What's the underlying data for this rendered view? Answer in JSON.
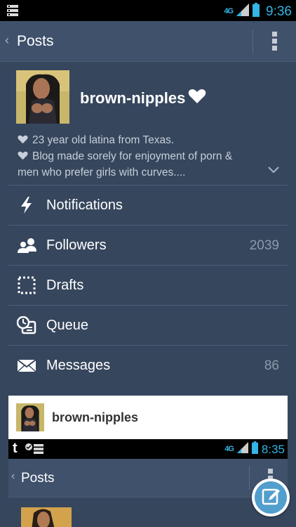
{
  "status_bar": {
    "network": "4G",
    "time": "9:36"
  },
  "action_bar": {
    "title": "Posts",
    "icons": [
      "chevron-left-icon",
      "overflow-menu-icon"
    ]
  },
  "profile": {
    "blog_name": "brown-nipples",
    "description_lines": [
      "23 year old latina from Texas.",
      "Blog made sorely for enjoyment of porn &",
      "men who prefer girls with curves...."
    ]
  },
  "menu": {
    "items": [
      {
        "label": "Notifications",
        "icon": "lightning-icon",
        "count": ""
      },
      {
        "label": "Followers",
        "icon": "followers-icon",
        "count": "2039"
      },
      {
        "label": "Drafts",
        "icon": "drafts-icon",
        "count": ""
      },
      {
        "label": "Queue",
        "icon": "queue-icon",
        "count": ""
      },
      {
        "label": "Messages",
        "icon": "envelope-icon",
        "count": "86"
      }
    ]
  },
  "card": {
    "blog_name": "brown-nipples"
  },
  "nested": {
    "network": "4G",
    "time": "8:35",
    "title": "Posts"
  },
  "colors": {
    "background": "#36465d",
    "action_bar": "#3f516b",
    "accent": "#529ecc",
    "status_text": "#33b5e5"
  }
}
